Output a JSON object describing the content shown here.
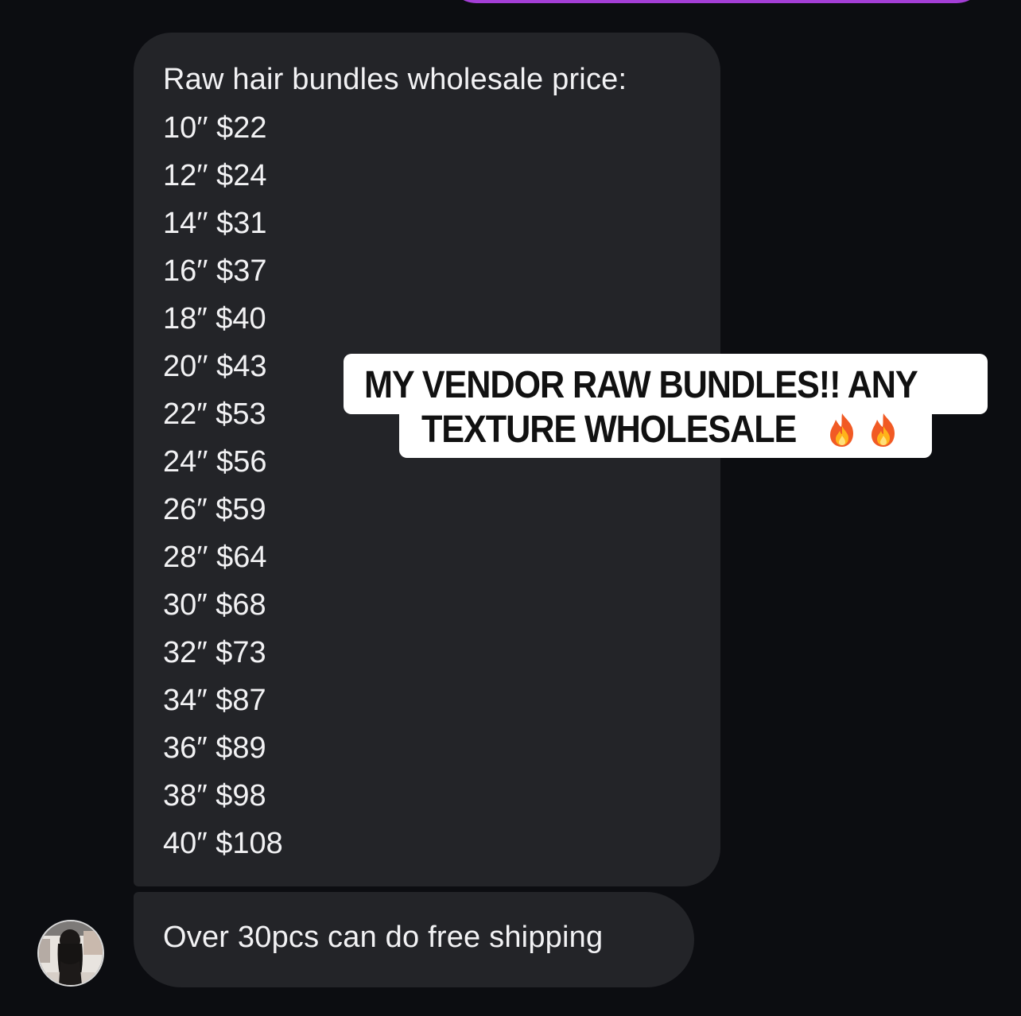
{
  "colors": {
    "background": "#0c0d11",
    "incoming_bubble": "#232428",
    "outgoing_bubble": "#a43ed6",
    "message_text": "#f2f2f4",
    "overlay_background": "#ffffff",
    "overlay_text": "#111111"
  },
  "messages": {
    "price_list": {
      "heading": "Raw hair bundles wholesale price:",
      "rows": [
        "10′′  $22",
        "12′′  $24",
        "14′′  $31",
        "16′′ $37",
        "18″ $40",
        "20′′ $43",
        "22″ $53",
        "24′′ $56",
        "26″ $59",
        "28′′ $64",
        "30″ $68",
        "32″ $73",
        "34″ $87",
        "36″ $89",
        "38″ $98",
        "40″ $108"
      ]
    },
    "shipping": {
      "text": "Over 30pcs can do free shipping"
    }
  },
  "overlay_caption": {
    "line1": "MY VENDOR RAW BUNDLES!! ANY",
    "line2": "TEXTURE WHOLESALE",
    "emoji_icons": [
      "fire-icon",
      "fire-icon"
    ]
  },
  "avatar": {
    "icon": "contact-avatar-photo"
  }
}
